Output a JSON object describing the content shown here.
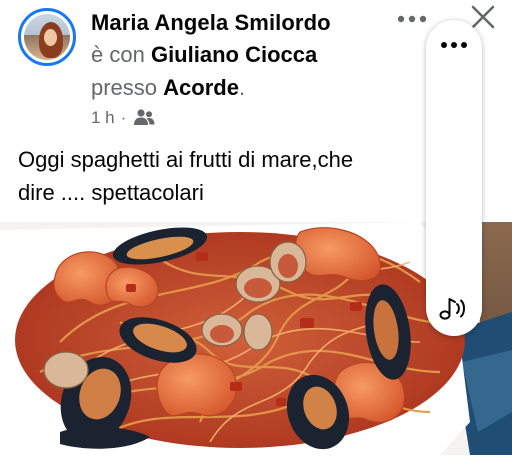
{
  "post": {
    "author_name": "Maria Angela Smilordo",
    "with_prefix": "è con",
    "with_name": "Giuliano Ciocca",
    "location_prefix": "presso",
    "location_name": "Acorde",
    "location_suffix": ".",
    "time": "1 h",
    "time_separator": "·",
    "audience_icon": "friends-icon",
    "text_line1": "Oggi spaghetti ai frutti di mare,che",
    "text_line2": "dire .... spettacolari"
  },
  "header_controls": {
    "more_icon": "more-horiz-icon",
    "close_icon": "close-icon"
  },
  "side_pill": {
    "more_icon": "more-horiz-icon",
    "sound_icon": "music-note-sound-icon"
  },
  "photo": {
    "subject": "seafood-spaghetti-photo"
  },
  "colors": {
    "accent": "#1877f2",
    "text_primary": "#050505",
    "text_secondary": "#65676b",
    "icon": "#65676b"
  }
}
